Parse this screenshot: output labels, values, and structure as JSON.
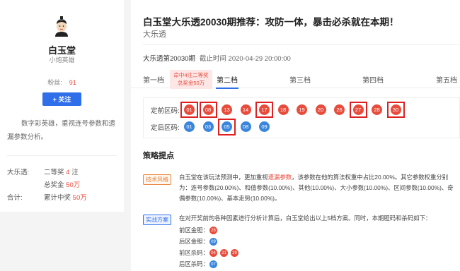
{
  "profile": {
    "name": "白玉堂",
    "title": "小炮英雄",
    "fans_label": "粉丝:",
    "fans_count": "91",
    "follow_label": "+ 关注",
    "description": "数字彩英雄，重视连号参数和遗漏参数分析。",
    "stats": {
      "lottery_label": "大乐透:",
      "lottery_prefix": "二等奖",
      "lottery_count": "4",
      "lottery_suffix": "注",
      "prize_prefix": "总奖金",
      "prize_value": "50万",
      "total_label": "合计:",
      "total_prefix": "累计中奖",
      "total_value": "50万"
    }
  },
  "article": {
    "title": "白玉堂大乐透20030期推荐：攻防一体，暴击必杀就在本期！",
    "subtitle": "大乐透",
    "issue": "大乐透第20030期",
    "deadline": "截止时间 2020-04-29 20:00:00"
  },
  "tabs": [
    "第一档",
    "第二档",
    "第三档",
    "第四档",
    "第五档"
  ],
  "active_tab": "第二档",
  "tip": {
    "line1": "命中4注二等奖",
    "line2": "总奖金50万"
  },
  "balls": {
    "front_label": "定前区码:",
    "back_label": "定后区码:",
    "front": [
      "01",
      "08",
      "13",
      "14",
      "17",
      "18",
      "19",
      "20",
      "26",
      "27",
      "28",
      "30"
    ],
    "back": [
      "01",
      "03",
      "05",
      "08",
      "09"
    ],
    "front_highlighted": [
      "01",
      "08",
      "17",
      "27",
      "30"
    ],
    "back_highlighted": [
      "05"
    ]
  },
  "strategy": {
    "section_title": "策略提点",
    "tech_tag": "技术风格",
    "tech_text_before": "白玉堂在该玩法预测中，更加重视",
    "tech_text_highlight": "遗漏参数",
    "tech_text_after": "，该参数在他的算法权重中占比20.00%。其它参数权重分别为：连号参数(20.00%)、和值参数(10.00%)、其他(10.00%)、大小参数(10.00%)、区间参数(10.00%)、奇偶参数(10.00%)、基本走势(10.00%)。",
    "plan_tag": "实战方案",
    "plan_text": "在对开奖前的各种因素进行分析计算后，白玉堂给出以上5档方案。同时，本期胆码和杀码如下：",
    "front_dan_label": "前区金胆：",
    "front_dan": [
      "26"
    ],
    "back_dan_label": "后区金胆：",
    "back_dan": [
      "09"
    ],
    "front_kill_label": "前区杀码：",
    "front_kill": [
      "04",
      "21",
      "29"
    ],
    "back_kill_label": "后区杀码：",
    "back_kill": [
      "07"
    ]
  },
  "colors": {
    "accent_blue": "#2f6fea",
    "red": "#e94b3c",
    "ball_red": "#e74c3c",
    "ball_blue": "#3a86dd",
    "highlight_box": "#e02020"
  }
}
